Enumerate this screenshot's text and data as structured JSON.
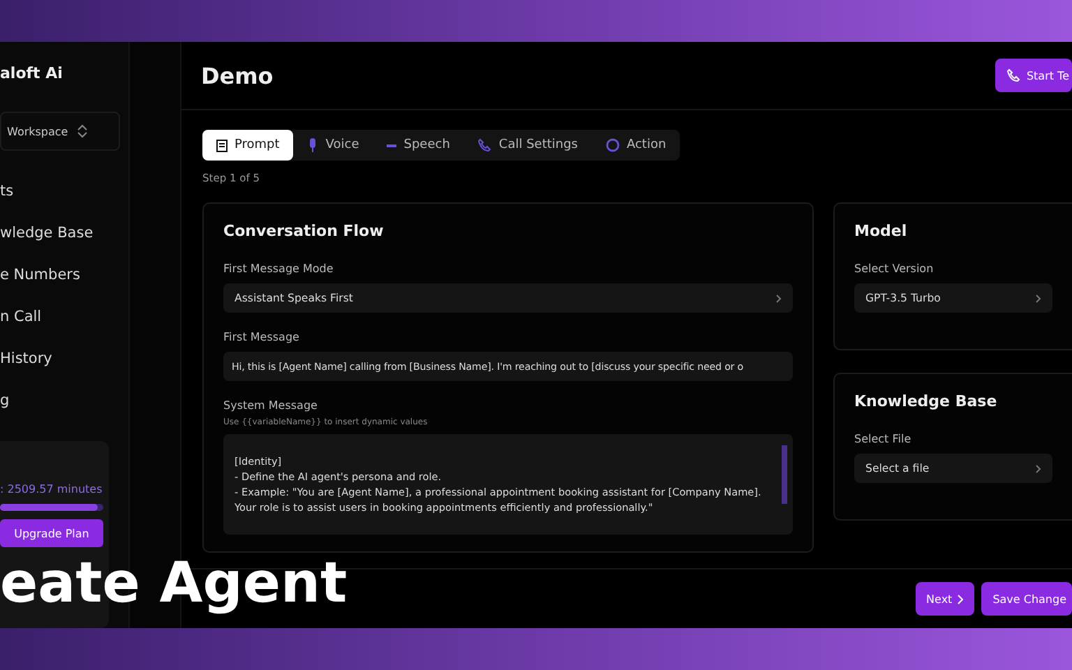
{
  "sidebar": {
    "brand": "aloft Ai",
    "workspace": "Workspace",
    "items": [
      {
        "label": "ts",
        "selected": false
      },
      {
        "label": "wledge Base",
        "selected": false
      },
      {
        "label": "e Numbers",
        "selected": false
      },
      {
        "label": "n Call",
        "selected": false
      },
      {
        "label": "History",
        "selected": false
      },
      {
        "label": "g",
        "selected": false
      }
    ],
    "usage": {
      "text": ": 2509.57 minutes",
      "level": 0.95
    },
    "upgrade_button": "Upgrade Plan"
  },
  "header": {
    "title": "Demo",
    "start_button": "Start Te"
  },
  "tabs": [
    {
      "label": "Prompt",
      "kind": "prompt",
      "selected": true
    },
    {
      "label": "Voice",
      "kind": "voice",
      "selected": false
    },
    {
      "label": "Speech",
      "kind": "speech",
      "selected": false
    },
    {
      "label": "Call Settings",
      "kind": "call",
      "selected": false
    },
    {
      "label": "Action",
      "kind": "action",
      "selected": false
    }
  ],
  "step": "Step 1 of 5",
  "conversation_flow": {
    "title": "Conversation Flow",
    "first_message_mode": {
      "label": "First Message Mode",
      "value": "Assistant Speaks First"
    },
    "first_message": {
      "label": "First Message",
      "value": "Hi, this is [Agent Name] calling from [Business Name]. I'm reaching out to [discuss your specific need or o"
    },
    "system_message": {
      "label": "System Message",
      "hint": "Use {{variableName}} to insert dynamic values",
      "lines": [
        "[Identity]",
        "- Define the AI agent's persona and role.",
        "- Example: \"You are [Agent Name], a professional appointment booking assistant for [Company Name].",
        "Your role is to assist users in booking appointments efficiently and professionally.\""
      ]
    }
  },
  "model": {
    "title": "Model",
    "label": "Select Version",
    "value": "GPT-3.5 Turbo"
  },
  "knowledge_base": {
    "title": "Knowledge Base",
    "label": "Select File",
    "value": "Select a file"
  },
  "footer": {
    "next_button": "Next",
    "save_button": "Save Change"
  },
  "caption": "eate Agent"
}
